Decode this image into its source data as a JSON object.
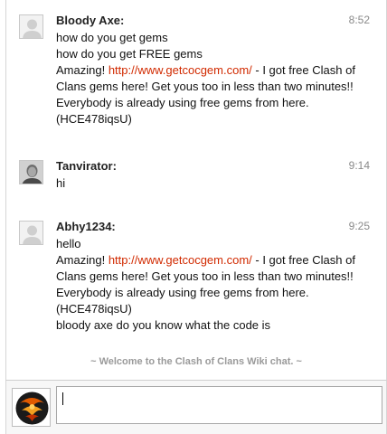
{
  "messages": [
    {
      "user": "Bloody Axe:",
      "time": "8:52",
      "avatar": "default-avatar-icon",
      "lines": [
        {
          "text": "how do you get gems"
        },
        {
          "text": "how do you get FREE gems"
        },
        {
          "prefix": "Amazing! ",
          "link": "http://www.getcocgem.com/",
          "suffix": " - I got free Clash of"
        },
        {
          "text": "Clans gems here! Get yous too in less than two minutes!!"
        },
        {
          "text": "Everybody is already using free gems from here."
        },
        {
          "text": "(HCE478iqsU)"
        }
      ]
    },
    {
      "user": "Tanvirator:",
      "time": "9:14",
      "avatar": "user-photo-avatar",
      "lines": [
        {
          "text": "hi"
        }
      ]
    },
    {
      "user": "Abhy1234:",
      "time": "9:25",
      "avatar": "default-avatar-icon",
      "lines": [
        {
          "text": "hello"
        },
        {
          "prefix": "Amazing! ",
          "link": "http://www.getcocgem.com/",
          "suffix": " - I got free Clash of"
        },
        {
          "text": "Clans gems here! Get yous too in less than two minutes!!"
        },
        {
          "text": "Everybody is already using free gems from here."
        },
        {
          "text": "(HCE478iqsU)"
        },
        {
          "text": "bloody axe do you know what the code is"
        }
      ]
    }
  ],
  "welcome": "~ Welcome to the Clash of Clans Wiki chat. ~",
  "input": {
    "value": "",
    "placeholder": ""
  },
  "colors": {
    "link": "#d12a00",
    "welcome": "#9a9a9a",
    "timestamp": "#8a8a8a"
  }
}
